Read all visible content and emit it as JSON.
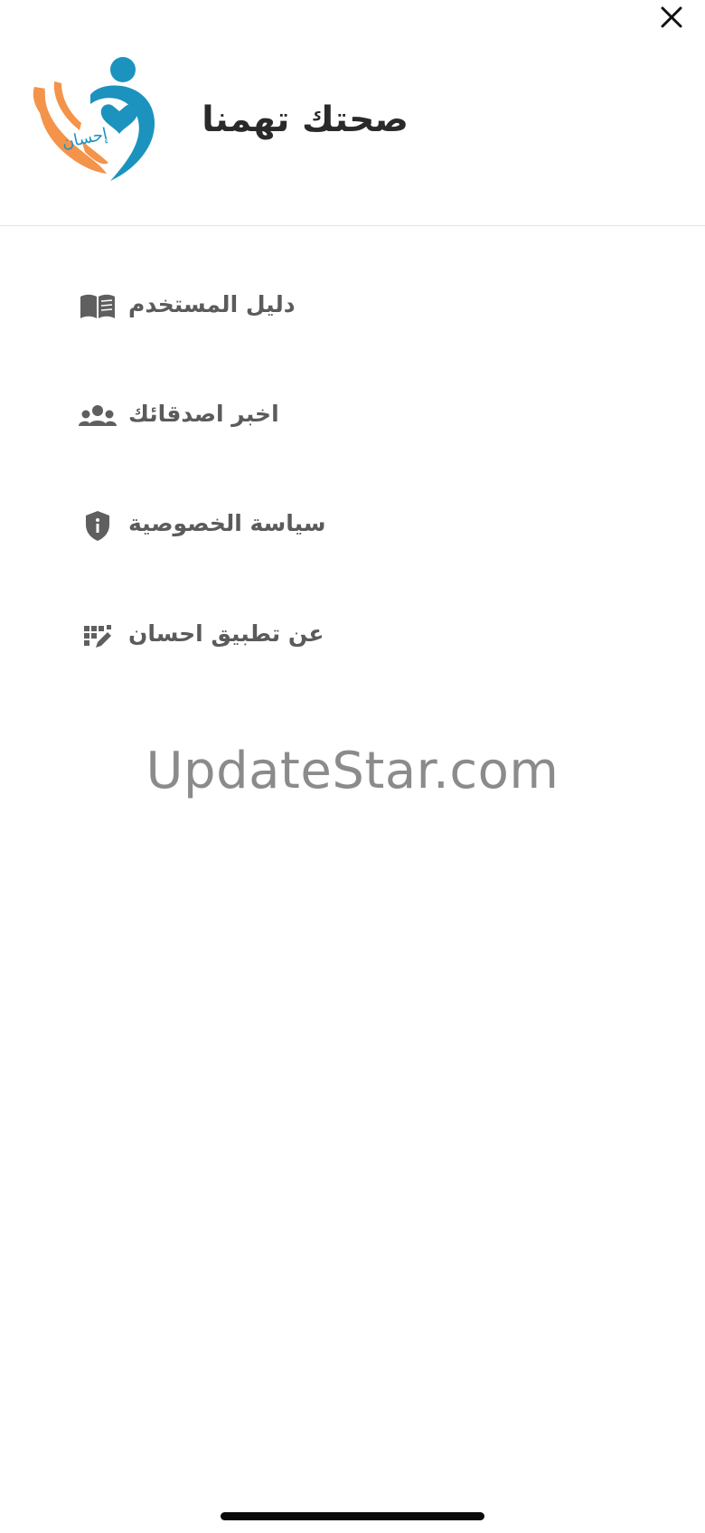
{
  "header": {
    "title": "صحتك تهمنا",
    "logo_text": "إحسان",
    "logo_colors": {
      "blue": "#1b93be",
      "orange": "#f4934a"
    }
  },
  "close": {
    "icon": "close-icon"
  },
  "menu": {
    "items": [
      {
        "label": "دليل المستخدم",
        "icon": "book-icon"
      },
      {
        "label": "اخبر اصدقائك",
        "icon": "people-icon"
      },
      {
        "label": "سياسة الخصوصية",
        "icon": "shield-info-icon"
      },
      {
        "label": "عن تطبيق احسان",
        "icon": "grid-edit-icon"
      }
    ],
    "icon_color": "#5f5f5f",
    "text_color": "#5b5b5b"
  },
  "watermark": {
    "text": "UpdateStar.com"
  }
}
